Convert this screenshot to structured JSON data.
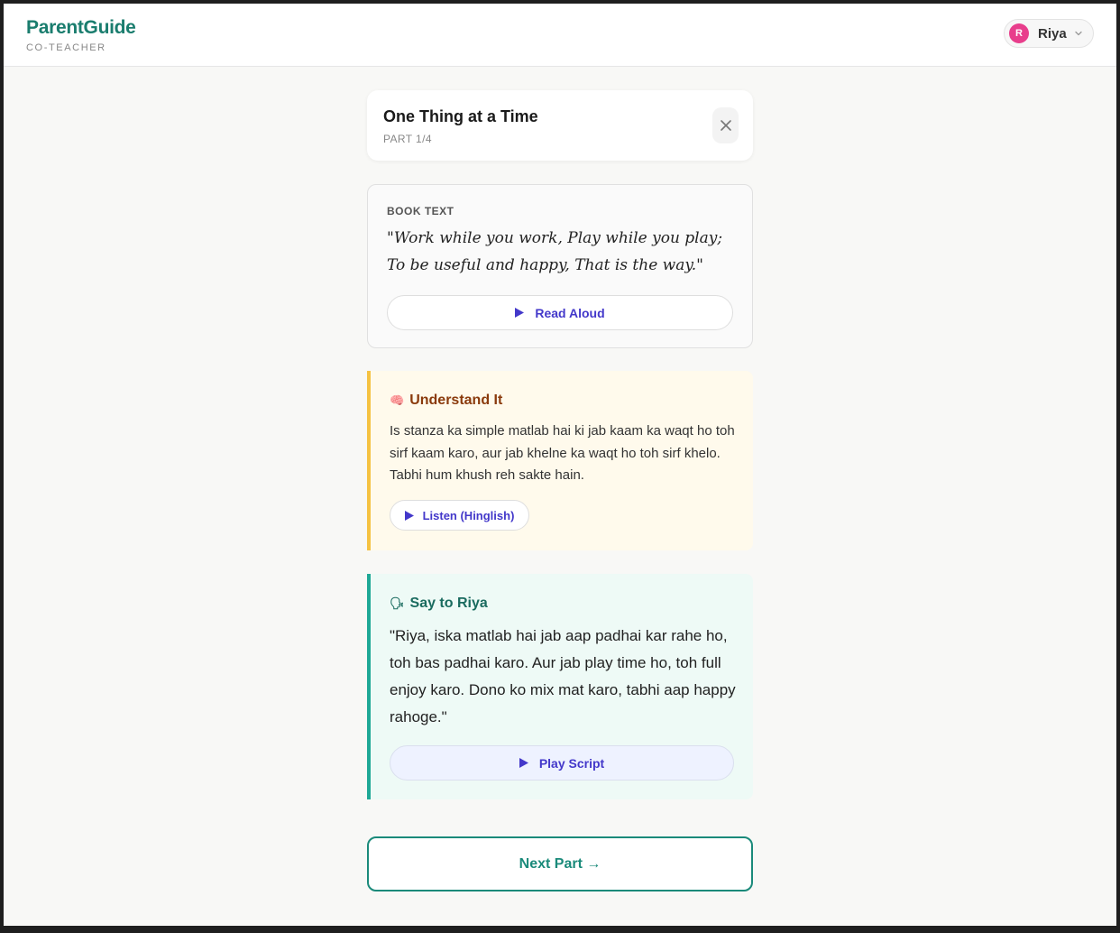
{
  "app": {
    "brand_name": "ParentGuide",
    "brand_subtitle": "CO-TEACHER"
  },
  "user": {
    "initial": "R",
    "name": "Riya",
    "avatar_color": "#e83e8c"
  },
  "lesson": {
    "title": "One Thing at a Time",
    "part_label": "PART 1/4"
  },
  "book": {
    "label": "BOOK TEXT",
    "quote_lines": [
      "\"Work while you work, Play while you play;",
      "To be useful and happy, That is the way.\""
    ],
    "read_button": "Read Aloud"
  },
  "understand": {
    "icon": "brain-icon",
    "emoji": "🧠",
    "title": "Understand It",
    "body": "Is stanza ka simple matlab hai ki jab kaam ka waqt ho toh sirf kaam karo, aur jab khelne ka waqt ho toh sirf khelo. Tabhi hum khush reh sakte hain.",
    "listen_button": "Listen (Hinglish)",
    "accent": "#f5c242"
  },
  "say": {
    "icon": "speaking-head-icon",
    "emoji": "🗣",
    "title": "Say to Riya",
    "body": "\"Riya, iska matlab hai jab aap padhai kar rahe ho, toh bas padhai karo. Aur jab play time ho, toh full enjoy karo. Dono ko mix mat karo, tabhi aap happy rahoge.\"",
    "play_button": "Play Script",
    "accent": "#1fa896"
  },
  "navigation": {
    "next_button": "Next Part →"
  },
  "colors": {
    "brand": "#1a7d6e",
    "action": "#4338ca"
  }
}
